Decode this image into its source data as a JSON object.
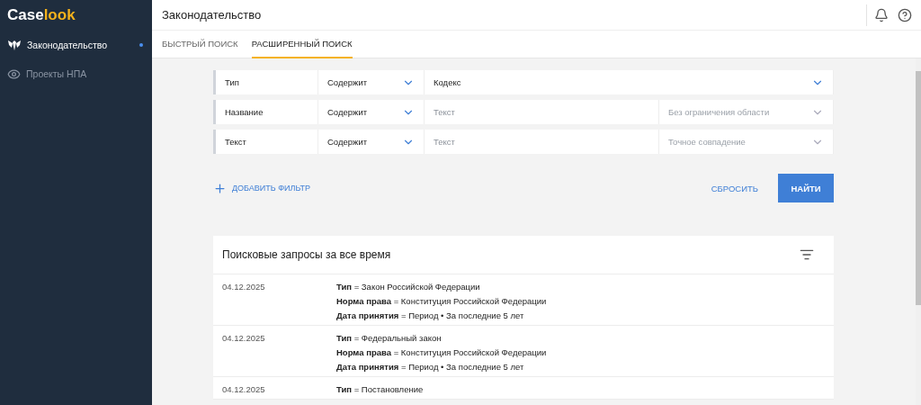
{
  "logo": {
    "first": "Case",
    "second": "look"
  },
  "sidebar": {
    "items": [
      {
        "label": "Законодательство",
        "selected": true
      },
      {
        "label": "Проекты НПА",
        "selected": false
      }
    ]
  },
  "header": {
    "title": "Законодательство"
  },
  "tabs": [
    {
      "label": "БЫСТРЫЙ ПОИСК",
      "selected": false
    },
    {
      "label": "РАСШИРЕННЫЙ ПОИСК",
      "selected": true
    }
  ],
  "filters": [
    {
      "field": "Тип",
      "operator": "Содержит",
      "value": "Кодекс"
    },
    {
      "field": "Название",
      "operator": "Содержит",
      "placeholder": "Текст",
      "scope_placeholder": "Без ограничения области"
    },
    {
      "field": "Текст",
      "operator": "Содержит",
      "placeholder": "Текст",
      "scope_placeholder": "Точное совпадение"
    }
  ],
  "add_filter": "ДОБАВИТЬ ФИЛЬТР",
  "reset_button": "СБРОСИТЬ",
  "find_button": "НАЙТИ",
  "history": {
    "title": "Поисковые запросы за все время",
    "entries": [
      {
        "date": "04.12.2025",
        "conditions": [
          "**Тип** = Закон Российской Федерации",
          "**Норма права** = Конституция Российской Федерации",
          "**Дата принятия** = Период • За последние 5 лет"
        ]
      },
      {
        "date": "04.12.2025",
        "conditions": [
          "**Тип** = Федеральный закон",
          "**Норма права** = Конституция Российской Федерации",
          "**Дата принятия** = Период • За последние 5 лет"
        ]
      },
      {
        "date": "04.12.2025",
        "conditions": [
          "**Тип** = Постановление"
        ]
      }
    ]
  }
}
